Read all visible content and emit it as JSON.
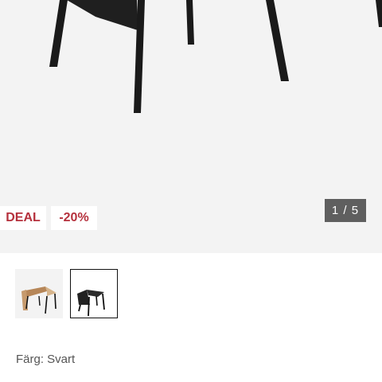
{
  "badges": {
    "deal": "DEAL",
    "discount": "-20%"
  },
  "gallery": {
    "counter": "1 / 5"
  },
  "thumbnails": [
    {
      "variant": "oak-black-legs"
    },
    {
      "variant": "black",
      "selected": true
    }
  ],
  "color": {
    "label": "Färg: Svart"
  },
  "colors": {
    "badge_text": "#b5303c",
    "counter_bg": "#5f5f5f",
    "gallery_bg": "#f3f3f3"
  }
}
